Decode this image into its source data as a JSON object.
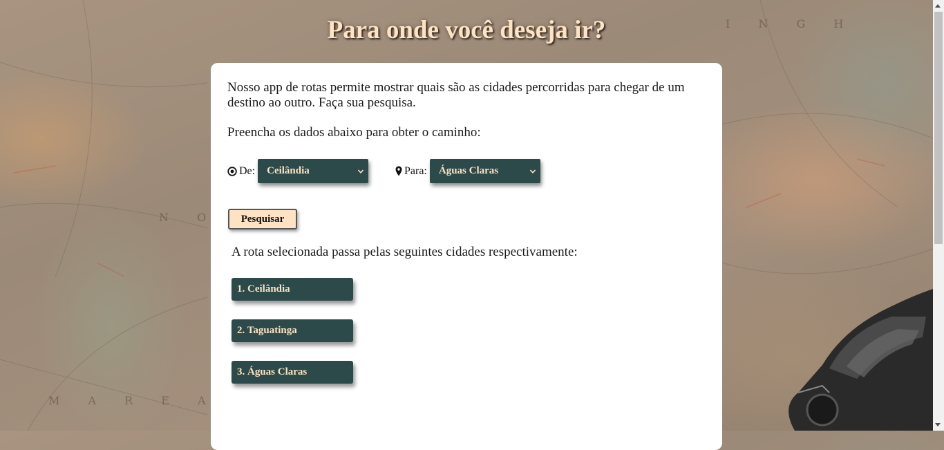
{
  "header": {
    "title": "Para onde você deseja ir?"
  },
  "intro": {
    "description": "Nosso app de rotas permite mostrar quais são as cidades percorridas para chegar de um destino ao outro. Faça sua pesquisa.",
    "instruction": "Preencha os dados abaixo para obter o caminho:"
  },
  "form": {
    "from": {
      "label": "De:",
      "icon": "dot-circle-icon",
      "selected": "Ceilândia"
    },
    "to": {
      "label": "Para:",
      "icon": "map-marker-icon",
      "selected": "Águas Claras"
    },
    "search_label": "Pesquisar"
  },
  "result": {
    "label": "A rota selecionada passa pelas seguintes cidades respectivamente:",
    "cities": [
      "1. Ceilândia",
      "2. Taguatinga",
      "3. Águas Claras"
    ]
  },
  "colors": {
    "accent_dark": "#2c4a4a",
    "accent_light": "#fde3c4"
  }
}
